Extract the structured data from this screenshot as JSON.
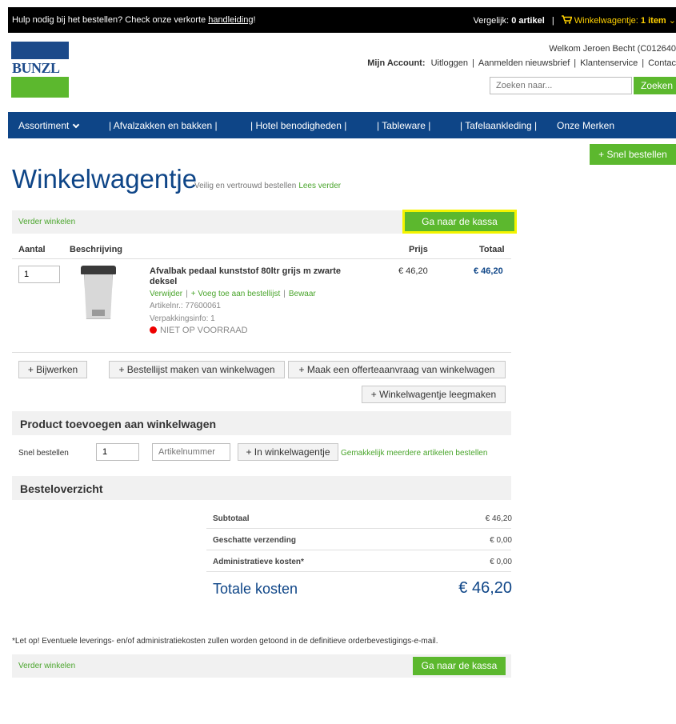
{
  "topbar": {
    "help_text": "Hulp nodig bij het bestellen? Check onze verkorte ",
    "help_link": "handleiding",
    "help_suffix": "!",
    "compare_label": "Vergelijk: ",
    "compare_value": "0 artikel",
    "cart_label": "Winkelwagentje: ",
    "cart_value": "1 item"
  },
  "logo": {
    "text": "BUNZL"
  },
  "header": {
    "welcome": "Welkom Jeroen Becht (C012640",
    "account_label": "Mijn Account:",
    "logout": "Uitloggen",
    "newsletter": "Aanmelden nieuwsbrief",
    "customer_service": "Klantenservice",
    "contact": "Contac",
    "search_placeholder": "Zoeken naar...",
    "search_button": "Zoeken"
  },
  "nav": {
    "items": [
      "Assortiment",
      "| Afvalzakken en bakken |",
      "| Hotel benodigheden |",
      "| Tableware |",
      "| Tafelaankleding |",
      "Onze Merken"
    ]
  },
  "quick_order_button": "+ Snel bestellen",
  "page": {
    "title": "Winkelwagentje",
    "subtitle": "Veilig en vertrouwd bestellen",
    "read_more": "Lees verder",
    "continue_shopping": "Verder winkelen",
    "checkout": "Ga naar de kassa"
  },
  "cart_table": {
    "headers": {
      "qty": "Aantal",
      "desc": "Beschrijving",
      "price": "Prijs",
      "total": "Totaal"
    },
    "item": {
      "qty": "1",
      "name": "Afvalbak pedaal kunststof 80ltr grijs m zwarte deksel",
      "remove": "Verwijder",
      "add_to_list": "+ Voeg toe aan bestellijst",
      "save": "Bewaar",
      "article_no": "Artikelnr.: 77600061",
      "packaging": "Verpakkingsinfo: 1",
      "stock": "NIET OP VOORRAAD",
      "price": "€ 46,20",
      "total": "€ 46,20"
    }
  },
  "actions": {
    "update": "+ Bijwerken",
    "make_list": "+ Bestellijst maken van winkelwagen",
    "quote": "+ Maak een offerteaanvraag van winkelwagen",
    "empty": "+ Winkelwagentje leegmaken"
  },
  "add_product": {
    "heading": "Product toevoegen aan winkelwagen",
    "quick_label": "Snel bestellen",
    "qty": "1",
    "article_placeholder": "Artikelnummer",
    "add_button": "+ In winkelwagentje",
    "hint": "Gemakkelijk meerdere artikelen bestellen"
  },
  "summary": {
    "heading": "Besteloverzicht",
    "rows": [
      {
        "label": "Subtotaal",
        "value": "€ 46,20"
      },
      {
        "label": "Geschatte verzending",
        "value": "€ 0,00"
      },
      {
        "label": "Administratieve kosten*",
        "value": "€ 0,00"
      }
    ],
    "grand_label": "Totale kosten",
    "grand_value": "€ 46,20"
  },
  "footnote": "*Let op! Eventuele leverings- en/of administratiekosten zullen worden getoond in de definitieve orderbevestigings-e-mail.",
  "colors": {
    "navy": "#0e4587",
    "green": "#5cb82e",
    "highlight": "#f4f400"
  }
}
